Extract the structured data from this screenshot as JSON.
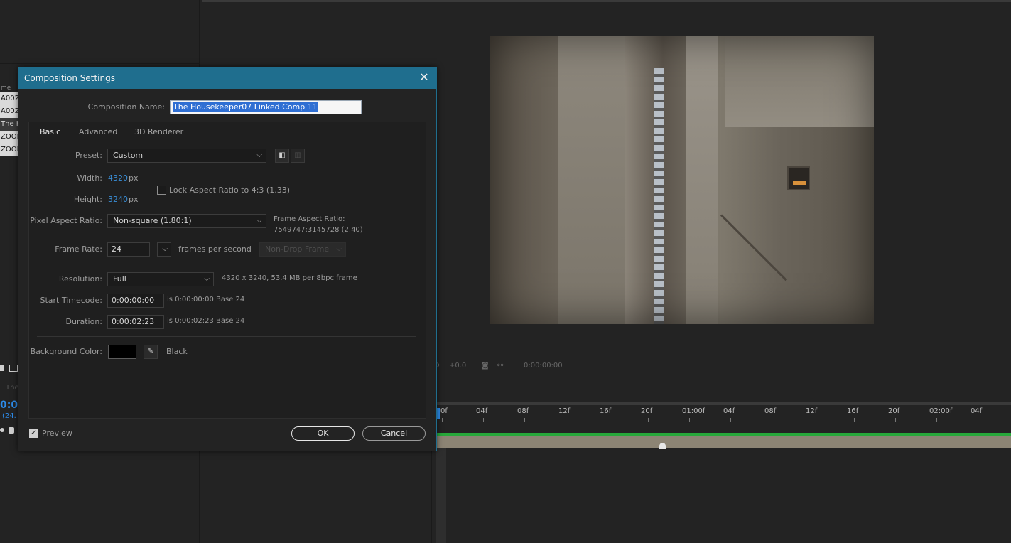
{
  "background": {
    "project_rows": [
      "me",
      "A002_",
      "A002_",
      "The H",
      "ZOOM",
      "ZOOM"
    ],
    "viewer_toolbar": {
      "exposure": "+0.0",
      "timecode": "0:00:00:00"
    },
    "timeline": {
      "ticks": [
        "0f",
        "04f",
        "08f",
        "12f",
        "16f",
        "20f",
        "01:00f",
        "04f",
        "08f",
        "12f",
        "16f",
        "20f",
        "02:00f",
        "04f",
        "0"
      ],
      "left_time": "0:0(",
      "left_fps": "(24.",
      "left_label": "The"
    }
  },
  "dialog": {
    "title": "Composition Settings",
    "composition_name_label": "Composition Name:",
    "composition_name": "The Housekeeper07 Linked Comp 11",
    "tabs": [
      "Basic",
      "Advanced",
      "3D Renderer"
    ],
    "preset_label": "Preset:",
    "preset": "Custom",
    "width_label": "Width:",
    "width": "4320",
    "height_label": "Height:",
    "height": "3240",
    "px": "px",
    "lock_aspect_label": "Lock Aspect Ratio to 4:3 (1.33)",
    "par_label": "Pixel Aspect Ratio:",
    "par": "Non-square (1.80:1)",
    "frame_aspect_label": "Frame Aspect Ratio:",
    "frame_aspect_value": "7549747:3145728 (2.40)",
    "frame_rate_label": "Frame Rate:",
    "frame_rate": "24",
    "fps_label": "frames per second",
    "drop_frame": "Non-Drop Frame",
    "resolution_label": "Resolution:",
    "resolution": "Full",
    "resolution_info": "4320 x 3240, 53.4 MB per 8bpc frame",
    "start_tc_label": "Start Timecode:",
    "start_tc": "0:00:00:00",
    "start_tc_info": "is 0:00:00:00  Base 24",
    "duration_label": "Duration:",
    "duration": "0:00:02:23",
    "duration_info": "is 0:00:02:23  Base 24",
    "bg_color_label": "Background Color:",
    "bg_color_name": "Black",
    "bg_color_hex": "#000000",
    "preview_label": "Preview",
    "ok_label": "OK",
    "cancel_label": "Cancel"
  },
  "colors": {
    "titlebar": "#1f6e8e",
    "accent_blue": "#3a8fd8",
    "timeline_green": "#27a83a"
  }
}
